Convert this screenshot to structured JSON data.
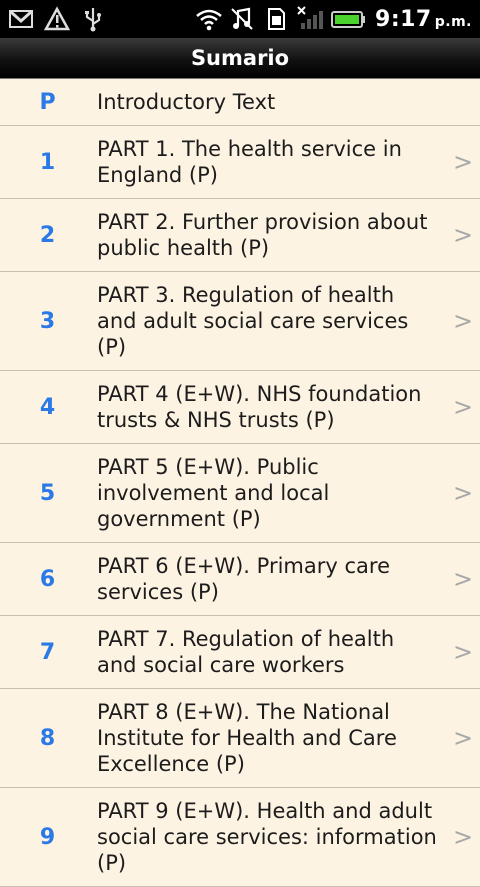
{
  "status": {
    "time": "9:17",
    "ampm": "p.m."
  },
  "header": {
    "title": "Sumario"
  },
  "rows": [
    {
      "num": "P",
      "label": "Introductory Text",
      "chevron": false
    },
    {
      "num": "1",
      "label": "PART 1. The health service in England (P)",
      "chevron": true
    },
    {
      "num": "2",
      "label": "PART 2. Further provision about public health (P)",
      "chevron": true
    },
    {
      "num": "3",
      "label": "PART 3. Regulation of health and adult social care services (P)",
      "chevron": true
    },
    {
      "num": "4",
      "label": "PART 4  (E+W). NHS foundation trusts & NHS trusts (P)",
      "chevron": true
    },
    {
      "num": "5",
      "label": "PART 5  (E+W). Public involvement and local government (P)",
      "chevron": true
    },
    {
      "num": "6",
      "label": "PART 6  (E+W). Primary care services (P)",
      "chevron": true
    },
    {
      "num": "7",
      "label": "PART 7. Regulation of health and social care workers",
      "chevron": true
    },
    {
      "num": "8",
      "label": "PART 8  (E+W). The National Institute for Health and Care Excellence (P)",
      "chevron": true
    },
    {
      "num": "9",
      "label": "PART 9  (E+W). Health and adult social care services: information (P)",
      "chevron": true
    }
  ],
  "chevron_glyph": ">"
}
